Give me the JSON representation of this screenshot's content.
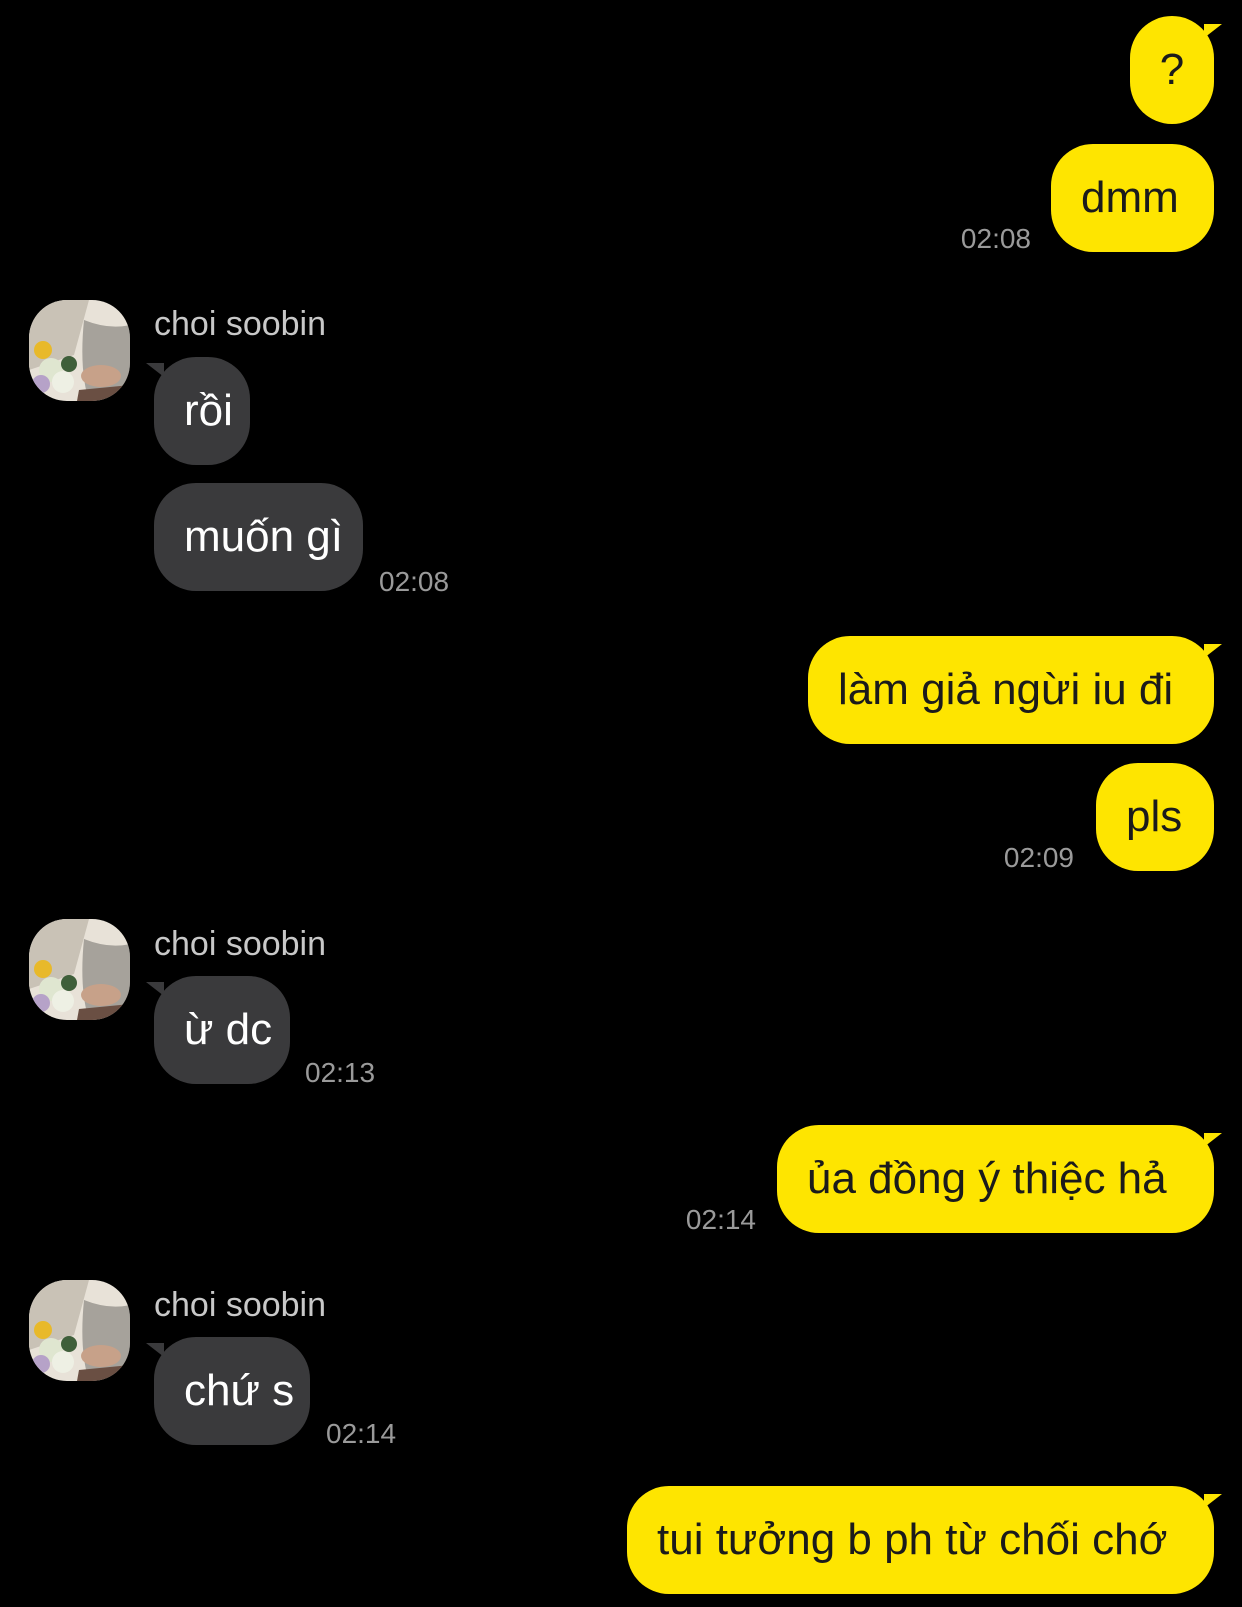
{
  "colors": {
    "background": "#000000",
    "outgoing_bubble": "#fee500",
    "incoming_bubble": "#3a3a3c",
    "timestamp": "#9a9a9a"
  },
  "contact": {
    "name": "choi soobin",
    "avatar_icon": "profile-photo-flowers"
  },
  "messages": [
    {
      "id": "m1",
      "dir": "out",
      "text": "?"
    },
    {
      "id": "m2",
      "dir": "out",
      "text": "dmm",
      "time": "02:08"
    },
    {
      "id": "m3",
      "dir": "in",
      "text": "rồi"
    },
    {
      "id": "m4",
      "dir": "in",
      "text": "muốn gì",
      "time": "02:08"
    },
    {
      "id": "m5",
      "dir": "out",
      "text": "làm giả ngừi iu đi"
    },
    {
      "id": "m6",
      "dir": "out",
      "text": "pls",
      "time": "02:09"
    },
    {
      "id": "m7",
      "dir": "in",
      "text": "ừ dc",
      "time": "02:13"
    },
    {
      "id": "m8",
      "dir": "out",
      "text": "ủa đồng ý thiệc hả",
      "time": "02:14"
    },
    {
      "id": "m9",
      "dir": "in",
      "text": "chứ s",
      "time": "02:14"
    },
    {
      "id": "m10",
      "dir": "out",
      "text": "tui tưởng b ph từ chối chớ"
    }
  ]
}
